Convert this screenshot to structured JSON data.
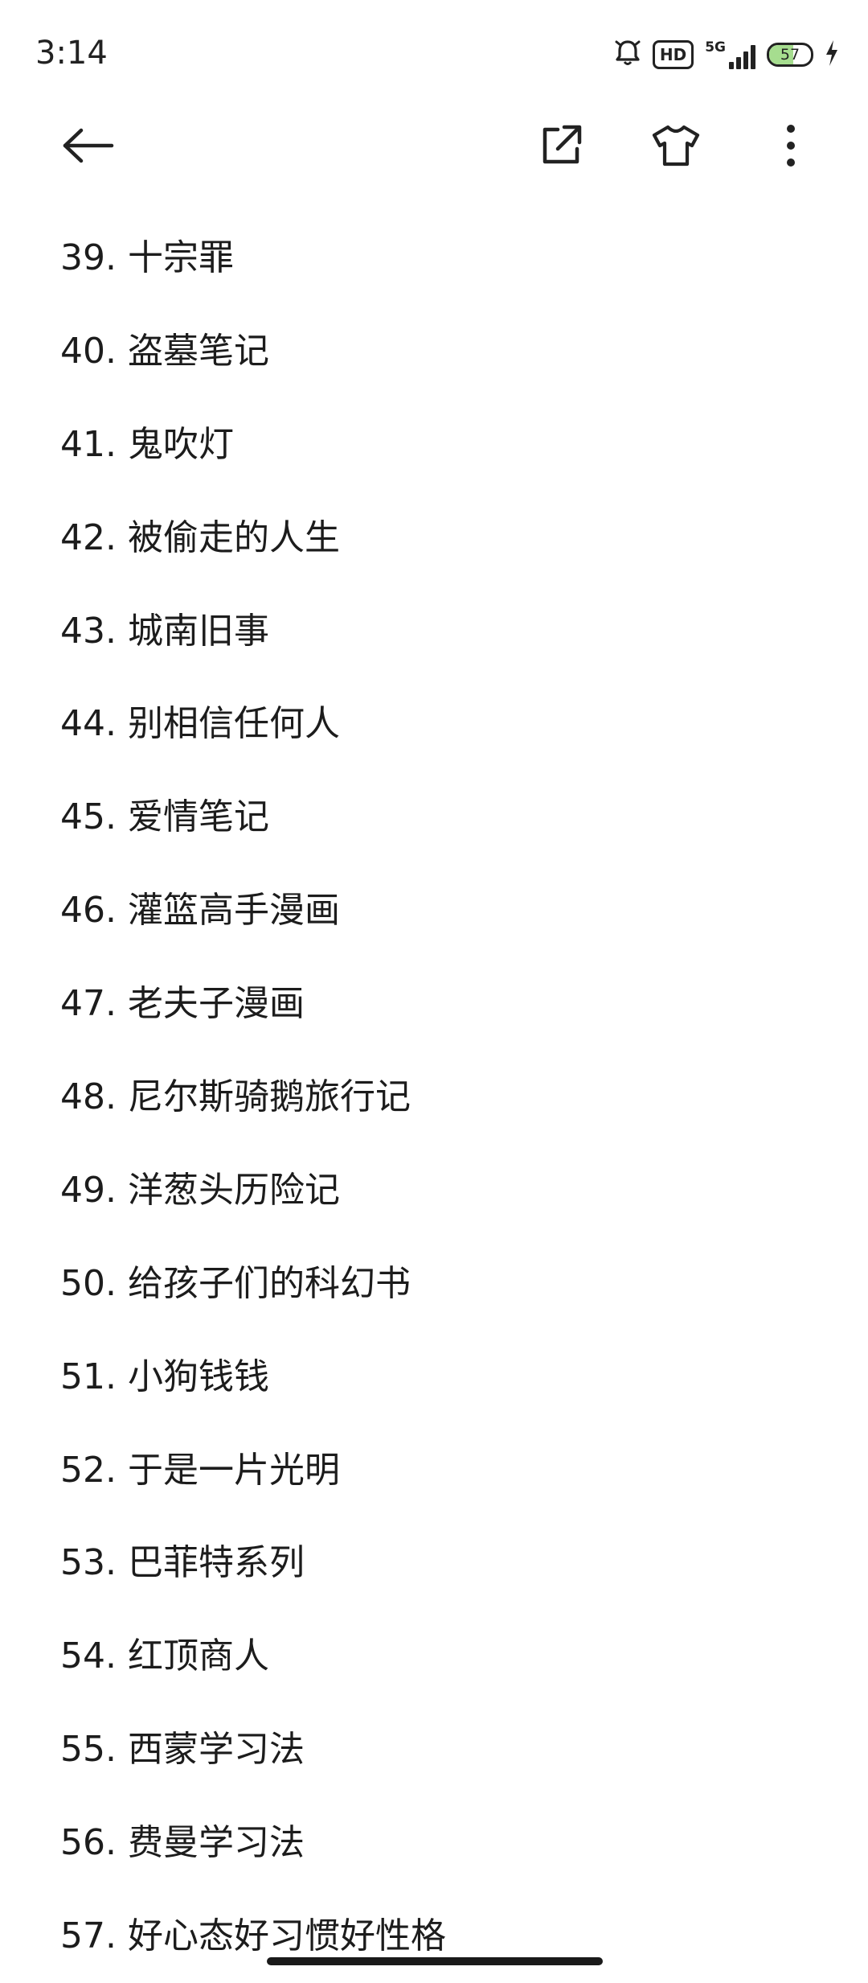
{
  "status_bar": {
    "time": "3:14",
    "network": "5G",
    "hd_label": "HD",
    "battery_level": 57,
    "battery_text": "57",
    "battery_color": "#a6dd8f"
  },
  "toolbar": {
    "back_icon": "arrow-left-icon",
    "share_icon": "external-share-icon",
    "theme_icon": "tshirt-icon",
    "more_icon": "more-vertical-icon"
  },
  "books": [
    "39. 十宗罪",
    "40. 盗墓笔记",
    "41. 鬼吹灯",
    "42. 被偷走的人生",
    "43. 城南旧事",
    "44. 别相信任何人",
    "45. 爱情笔记",
    "46. 灌篮高手漫画",
    "47. 老夫子漫画",
    "48. 尼尔斯骑鹅旅行记",
    "49. 洋葱头历险记",
    "50. 给孩子们的科幻书",
    "51. 小狗钱钱",
    "52. 于是一片光明",
    "53. 巴菲特系列",
    "54. 红顶商人",
    "55. 西蒙学习法",
    "56. 费曼学习法",
    "57. 好心态好习惯好性格"
  ]
}
